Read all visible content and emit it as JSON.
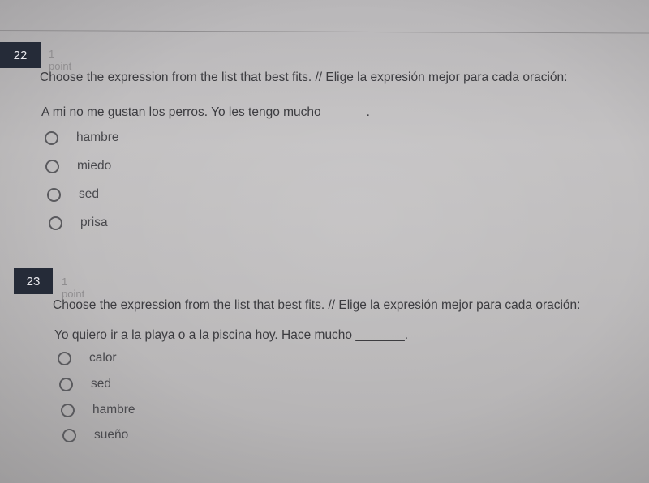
{
  "questions": [
    {
      "number": "22",
      "points": "1 point",
      "instruction": "Choose the expression from the list that best fits. // Elige la expresión mejor para cada oración:",
      "prompt": "A mi no me gustan los perros. Yo les tengo mucho ______.",
      "options": [
        "hambre",
        "miedo",
        "sed",
        "prisa"
      ]
    },
    {
      "number": "23",
      "points": "1 point",
      "instruction": "Choose the expression from the list that best fits. // Elige la expresión mejor para cada oración:",
      "prompt": "Yo quiero ir a la playa o a la piscina hoy. Hace mucho _______.",
      "options": [
        "calor",
        "sed",
        "hambre",
        "sueño"
      ]
    }
  ]
}
